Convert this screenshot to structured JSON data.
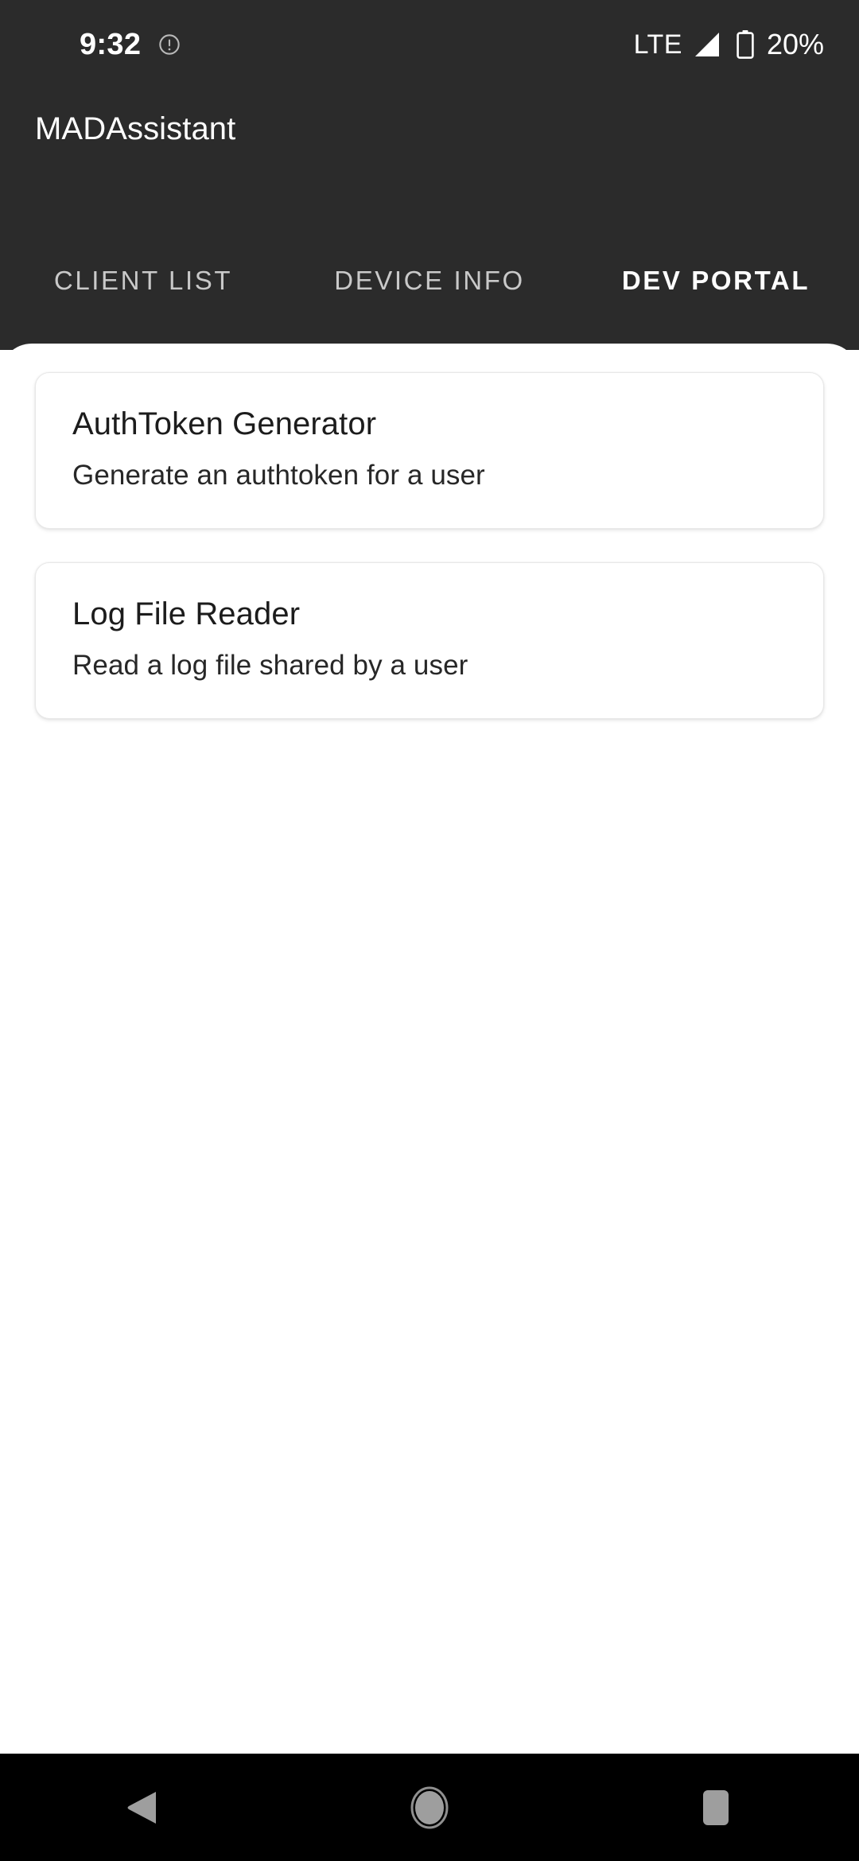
{
  "status_bar": {
    "time": "9:32",
    "alert_icon": "alert-circle-icon",
    "network_label": "LTE",
    "signal_icon": "signal-bars-icon",
    "battery_icon": "battery-icon",
    "battery_label": "20%"
  },
  "app_bar": {
    "title": "MADAssistant"
  },
  "tabs": [
    {
      "label": "CLIENT LIST",
      "active": false
    },
    {
      "label": "DEVICE INFO",
      "active": false
    },
    {
      "label": "DEV PORTAL",
      "active": true
    }
  ],
  "cards": [
    {
      "title": "AuthToken Generator",
      "subtitle": "Generate an authtoken for a user"
    },
    {
      "title": "Log File Reader",
      "subtitle": "Read a log file shared by a user"
    }
  ],
  "nav_bar": {
    "back_icon": "back-triangle-icon",
    "home_icon": "home-circle-icon",
    "recents_icon": "recents-square-icon"
  },
  "colors": {
    "chrome_background": "#2b2b2b",
    "content_background": "#ffffff",
    "active_tab": "#ffffff",
    "inactive_tab": "#c9c9c9",
    "nav_background": "#000000",
    "nav_icon": "#9e9e9e",
    "card_border": "#e8e8e8",
    "title_text": "#1c1c1c"
  }
}
